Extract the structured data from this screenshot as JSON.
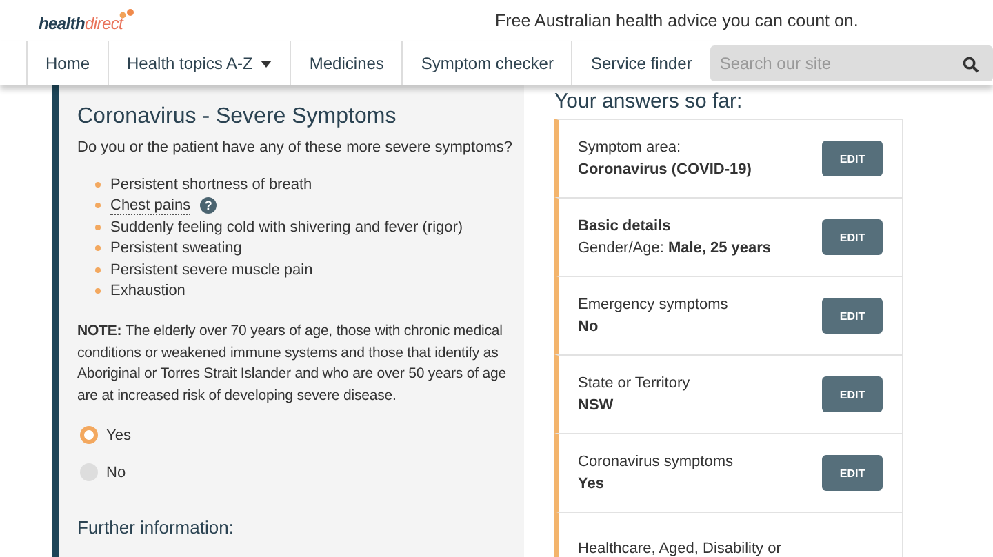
{
  "header": {
    "logo": "**health**direct",
    "tagline": "Free Australian health advice you can count on."
  },
  "nav": {
    "items": [
      {
        "label": "Home",
        "dropdown": false
      },
      {
        "label": "Health topics A-Z",
        "dropdown": true
      },
      {
        "label": "Medicines",
        "dropdown": false
      },
      {
        "label": "Symptom checker",
        "dropdown": false
      },
      {
        "label": "Service finder",
        "dropdown": false
      }
    ],
    "search": {
      "placeholder": "Search our site"
    }
  },
  "question": {
    "title": "Coronavirus - Severe Symptoms",
    "prompt": "Do you or the patient have any of these more severe symptoms?",
    "symptoms": [
      {
        "text": "Persistent shortness of breath",
        "help": false
      },
      {
        "text": "Chest pains",
        "help": "?"
      },
      {
        "text": "Suddenly feeling cold with shivering and fever (rigor)",
        "help": false
      },
      {
        "text": "Persistent sweating",
        "help": false
      },
      {
        "text": "Persistent severe muscle pain",
        "help": false
      },
      {
        "text": "Exhaustion",
        "help": false
      }
    ],
    "note": "**NOTE:** The elderly over 70 years of age, those with chronic medical conditions or weakened immune systems and those that identify as Aboriginal or Torres Strait Islander and who are over 50 years of age are at increased risk of developing severe disease.",
    "options": [
      {
        "label": "Yes",
        "selected": true
      },
      {
        "label": "No",
        "selected": false
      }
    ],
    "further": "Further information:"
  },
  "answers": {
    "title": "Your answers so far:",
    "items": [
      {
        "kind": "field",
        "label": "Symptom area:",
        "value": "Coronavirus (COVID-19)",
        "button": "EDIT"
      },
      {
        "kind": "details",
        "label": "Basic details",
        "value": "Gender/Age: **Male, 25 years**",
        "button": "EDIT"
      },
      {
        "kind": "field",
        "label": "Emergency symptoms",
        "value": "No",
        "button": "EDIT"
      },
      {
        "kind": "field",
        "label": "State or Territory",
        "value": "NSW",
        "button": "EDIT"
      },
      {
        "kind": "field",
        "label": "Coronavirus symptoms",
        "value": "Yes",
        "button": "EDIT"
      },
      {
        "kind": "field",
        "label": "Healthcare, Aged, Disability or"
      }
    ]
  }
}
